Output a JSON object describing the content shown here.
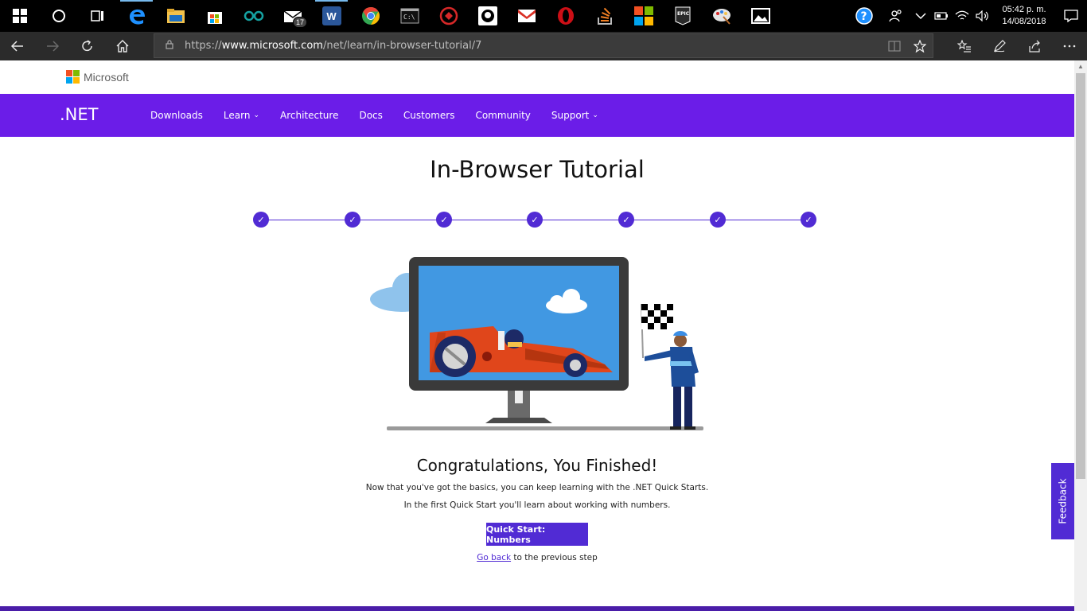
{
  "taskbar": {
    "apps": [
      {
        "name": "windows-start",
        "color": "#000000"
      },
      {
        "name": "cortana",
        "color": "#000000"
      },
      {
        "name": "task-view",
        "color": "#000000"
      },
      {
        "name": "edge",
        "color": "#1e90ff"
      },
      {
        "name": "file-explorer",
        "color": "#f3c14a"
      },
      {
        "name": "store",
        "color": "#3a8ee6"
      },
      {
        "name": "arduino",
        "color": "#15a2a2"
      },
      {
        "name": "mail",
        "color": "#ffffff"
      },
      {
        "name": "word",
        "color": "#2b579a"
      },
      {
        "name": "chrome",
        "color": "#e94235"
      },
      {
        "name": "terminal",
        "color": "#222222"
      },
      {
        "name": "red-app",
        "color": "#d62828"
      },
      {
        "name": "github",
        "color": "#ffffff"
      },
      {
        "name": "gmail",
        "color": "#d93025"
      },
      {
        "name": "opera",
        "color": "#cc0f16"
      },
      {
        "name": "stackoverflow",
        "color": "#f48024"
      },
      {
        "name": "microsoft-app",
        "color": "#f25022"
      },
      {
        "name": "epic-games",
        "color": "#2a2a2a"
      },
      {
        "name": "paint",
        "color": "#e4e4e4"
      },
      {
        "name": "photos",
        "color": "#ffffff"
      }
    ],
    "mail_badge": "17",
    "clock_time": "05:42 p. m.",
    "clock_date": "14/08/2018"
  },
  "browser": {
    "url_prefix": "https://",
    "url_host": "www.microsoft.com",
    "url_path": "/net/learn/in-browser-tutorial/7"
  },
  "site": {
    "brand": "Microsoft",
    "dotnet_brand": ".NET",
    "menu": [
      {
        "label": "Downloads",
        "has_dropdown": false
      },
      {
        "label": "Learn",
        "has_dropdown": true
      },
      {
        "label": "Architecture",
        "has_dropdown": false
      },
      {
        "label": "Docs",
        "has_dropdown": false
      },
      {
        "label": "Customers",
        "has_dropdown": false
      },
      {
        "label": "Community",
        "has_dropdown": false
      },
      {
        "label": "Support",
        "has_dropdown": true
      }
    ]
  },
  "main": {
    "title": "In-Browser Tutorial",
    "steps_completed": 7,
    "steps_total": 7,
    "congrats": "Congratulations, You Finished!",
    "desc1": "Now that you've got the basics, you can keep learning with the .NET Quick Starts.",
    "desc2": "In the first Quick Start you'll learn about working with numbers.",
    "cta_label": "Quick Start: Numbers",
    "go_back_link": "Go back",
    "go_back_rest": " to the previous step",
    "feedback_label": "Feedback"
  },
  "colors": {
    "nav_purple": "#6b1de8",
    "accent": "#512bd4"
  }
}
